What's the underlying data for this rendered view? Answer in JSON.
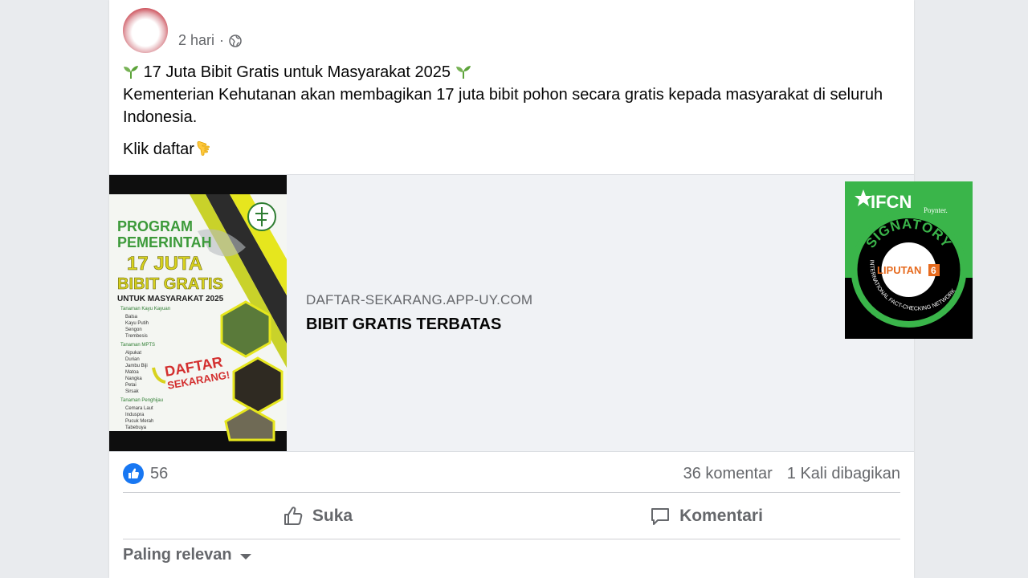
{
  "post": {
    "time": "2 hari",
    "separator": "·",
    "headline": "17 Juta Bibit Gratis untuk Masyarakat 2025",
    "body": "Kementerian Kehutanan akan membagikan 17 juta bibit pohon secara gratis kepada masyarakat di seluruh Indonesia.",
    "cta": "Klik daftar"
  },
  "link": {
    "domain": "DAFTAR-SEKARANG.APP-UY.COM",
    "title": "BIBIT GRATIS TERBATAS"
  },
  "poster": {
    "line1": "PROGRAM",
    "line2": "PEMERINTAH",
    "line3": "17 JUTA",
    "line4": "BIBIT GRATIS",
    "line5": "UNTUK MASYARAKAT 2025",
    "cta1": "DAFTAR",
    "cta2": "SEKARANG!",
    "section1": "Tanaman Kayu Kayuan",
    "section1_items": [
      "Balsa",
      "Kayu Putih",
      "Sengon",
      "Trembesis"
    ],
    "section2": "Tanaman MPTS",
    "section2_items": [
      "Alpukat",
      "Durian",
      "Jambu Biji",
      "Matoa",
      "Nangka",
      "Petai",
      "Sirsak"
    ],
    "section3": "Tanaman Penghijau",
    "section3_items": [
      "Cemara Laut",
      "Induspra",
      "Pucuk Merah",
      "Tabebuya"
    ]
  },
  "badge": {
    "org": "IFCN",
    "by": "Poynter.",
    "ring_text": "SIGNATORY",
    "sub_text": "INTERNATIONAL FACT-CHECKING NETWORK",
    "center_brand": "LIPUTAN",
    "center_num": "6"
  },
  "stats": {
    "likes": "56",
    "comments": "36 komentar",
    "shares": "1 Kali dibagikan"
  },
  "actions": {
    "like": "Suka",
    "comment": "Komentari"
  },
  "sort": {
    "label": "Paling relevan"
  },
  "colors": {
    "facebook_blue": "#1877f2",
    "ifcn_green": "#3ab54a",
    "poster_yellow": "#e6e61e"
  }
}
